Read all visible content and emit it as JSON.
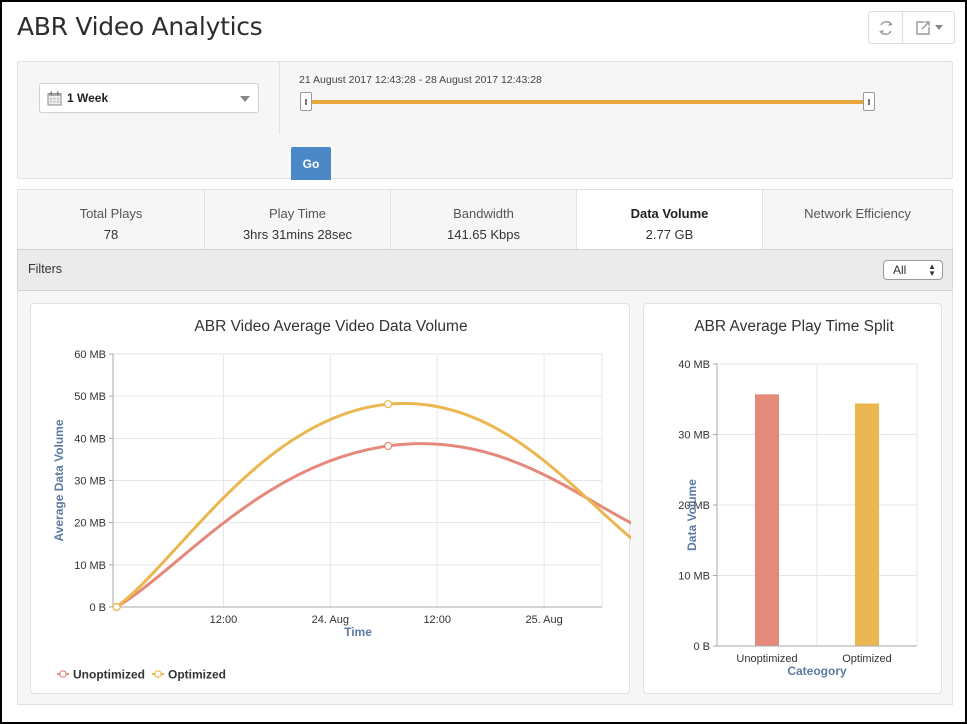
{
  "header": {
    "title": "ABR Video Analytics",
    "tools": [
      {
        "name": "refresh-icon"
      },
      {
        "name": "export-icon"
      }
    ]
  },
  "time_selector": {
    "period_icon": "calendar-icon",
    "period_value": "1 Week",
    "range_label": "21 August 2017 12:43:28 - 28 August 2017 12:43:28",
    "range_start_fraction": 0,
    "range_end_fraction": 1,
    "go_label": "Go"
  },
  "tabs": [
    {
      "name": "Total Plays",
      "value": "78",
      "active": false
    },
    {
      "name": "Play Time",
      "value": "3hrs 31mins 28sec",
      "active": false
    },
    {
      "name": "Bandwidth",
      "value": "141.65 Kbps",
      "active": false
    },
    {
      "name": "Data Volume",
      "value": "2.77 GB",
      "active": true
    },
    {
      "name": "Network Efficiency",
      "value": "",
      "active": false
    }
  ],
  "filters": {
    "label": "Filters",
    "selected": "All"
  },
  "colors": {
    "unoptimized": "#e5897a",
    "optimized": "#ebb751",
    "axis_title": "#5b7ba3",
    "slider": "#e8a63c",
    "go_button": "#4b88c8"
  },
  "chart_data": [
    {
      "type": "line",
      "title": "ABR Video Average Video Data Volume",
      "xlabel": "Time",
      "ylabel": "Average Data Volume",
      "x_ticks": [
        "12:00",
        "24. Aug",
        "12:00",
        "25. Aug"
      ],
      "x_tick_hours": [
        12,
        24,
        36,
        48
      ],
      "x_range_hours": [
        -0.4,
        54.5
      ],
      "x_points_hours": [
        0,
        30.5,
        60.5
      ],
      "x_points_note": "hours since 23 Aug 00:00",
      "y_ticks": [
        "0 B",
        "10 MB",
        "20 MB",
        "30 MB",
        "40 MB",
        "50 MB",
        "60 MB"
      ],
      "ylim": [
        0,
        60
      ],
      "y_unit": "MB",
      "grid": true,
      "legend": "bottom-left",
      "series": [
        {
          "name": "Unoptimized",
          "values": [
            0,
            38.2,
            17.5
          ]
        },
        {
          "name": "Optimized",
          "values": [
            0,
            48.1,
            12.3
          ]
        }
      ]
    },
    {
      "type": "bar",
      "title": "ABR Average Play Time Split",
      "xlabel": "Cateogory",
      "ylabel": "Data Volume",
      "categories": [
        "Unoptimized",
        "Optimized"
      ],
      "values": [
        35.7,
        34.4
      ],
      "y_ticks": [
        "0 B",
        "10 MB",
        "20 MB",
        "30 MB",
        "40 MB"
      ],
      "ylim": [
        0,
        40
      ],
      "y_unit": "MB",
      "grid": true
    }
  ]
}
